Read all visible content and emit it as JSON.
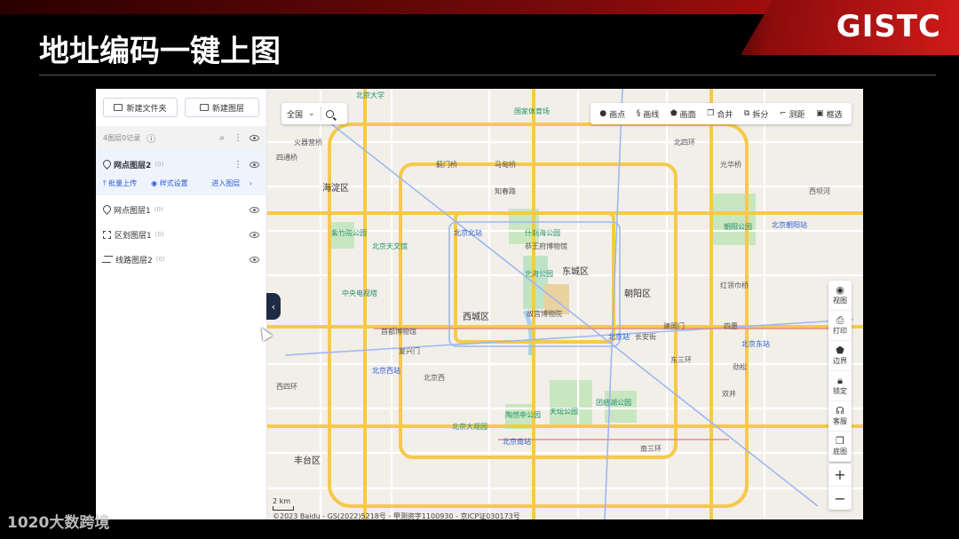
{
  "slide": {
    "title": "地址编码一键上图",
    "logo": "GISTC",
    "watermark": "1020大数跨境"
  },
  "sidebar": {
    "new_folder": "新建文件夹",
    "new_layer": "新建图层",
    "count_text": "4图层0记录",
    "active_layer": {
      "name": "网点图层2",
      "count": "(0)",
      "batch_upload": "批量上传",
      "style_settings": "样式设置",
      "enter_layer": "进入图层"
    },
    "layers": [
      {
        "name": "网点图层1",
        "count": "(0)",
        "icon": "pin-icon"
      },
      {
        "name": "区划图层1",
        "count": "(0)",
        "icon": "polygon-icon"
      },
      {
        "name": "线路图层2",
        "count": "(0)",
        "icon": "line-icon"
      }
    ]
  },
  "map": {
    "search_scope": "全国",
    "toolbar": [
      "画点",
      "画线",
      "画面",
      "合并",
      "拆分",
      "测距",
      "框选"
    ],
    "right_tools": [
      "视图",
      "打印",
      "边界",
      "锁定",
      "客服",
      "底图"
    ],
    "scale": "2 km",
    "copyright": "©2023 Baidu - GS(2022)5218号 - 甲测资字1100930 - 京ICP证030173号",
    "districts": [
      "海淀区",
      "西城区",
      "东城区",
      "朝阳区",
      "丰台区"
    ],
    "labels": [
      "北京大学",
      "国家体育场",
      "光华桥",
      "火器营桥",
      "西坝河",
      "北四环",
      "四通桥",
      "蓟门桥",
      "马甸桥",
      "知春路",
      "紫竹院公园",
      "北京天文馆",
      "北京北站",
      "什刹海公园",
      "恭王府博物馆",
      "北海公园",
      "故宫博物院",
      "中央电视塔",
      "首都博物馆",
      "北京西站",
      "北京西",
      "北京南站",
      "天坛公园",
      "陶然亭公园",
      "北京大观园",
      "北京站",
      "北京东站",
      "团结湖公园",
      "朝阳公园",
      "红领巾桥",
      "四惠",
      "双井",
      "劲松",
      "西四环",
      "东三环",
      "南三环",
      "长安街",
      "复兴门",
      "建国门",
      "北京朝阳站"
    ]
  },
  "colors": {
    "accent": "#d11a1a",
    "link": "#2a5bd7",
    "road_major": "#f7c94a",
    "ring_road": "#9db8f0"
  }
}
